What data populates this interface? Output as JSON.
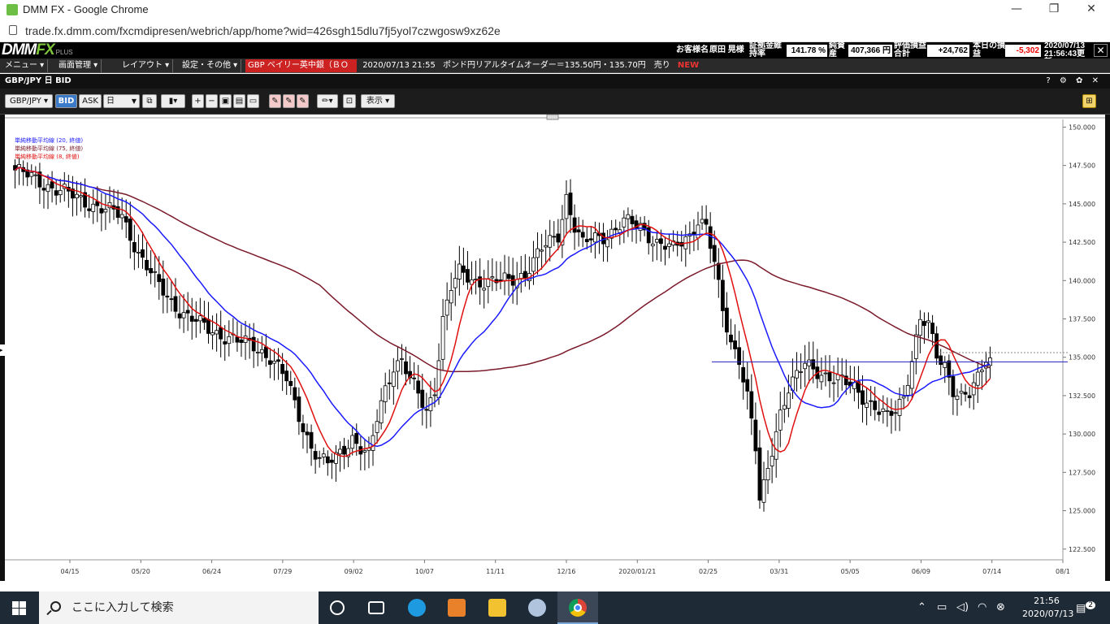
{
  "window": {
    "title": "DMM FX - Google Chrome",
    "url": "trade.fx.dmm.com/fxcmdipresen/webrich/app/home?wid=426sgh15dlu7fj5yol7czwgosw9xz62e"
  },
  "app": {
    "logo_main": "DMM",
    "logo_fx": "FX",
    "logo_plus": "PLUS",
    "account": {
      "name_label": "お客様名",
      "name_value": "原田 晃様",
      "margin_label": "証拠金維持率",
      "margin_value": "141.78 %",
      "equity_label": "純資産",
      "equity_value": "407,366 円",
      "eval_label": "評価損益合計",
      "eval_value": "+24,762 円",
      "today_label": "本日の損益",
      "today_value": "-5,302",
      "today_unit": "円",
      "updated_date": "2020/07/13",
      "updated_time": "21:56:43更新"
    },
    "menu": [
      "メニュー ▾",
      "画面管理 ▾",
      "レイアウト ▾",
      "設定・その他 ▾"
    ],
    "ticker": {
      "scroll": "GBP ベイリー英中銀（ＢＯ",
      "time": "2020/07/13 21:55",
      "text": "ポンド円リアルタイムオーダー＝135.50円・135.70円　売り",
      "new": "NEW"
    },
    "panel": {
      "title": "GBP/JPY 日 BID",
      "controls": "? ⚙ ✿ ✕"
    },
    "toolbar": {
      "pair": "GBP/JPY ▾",
      "bid": "BID",
      "ask": "ASK",
      "period": "日",
      "display": "表示 ▾"
    }
  },
  "chart_data": {
    "type": "candlestick",
    "title": "GBP/JPY 日 BID",
    "legend": [
      "単純移動平均線 (20, 終値)",
      "単純移動平均線 (75, 終値)",
      "単純移動平均線 (8, 終値)"
    ],
    "legend_colors": [
      "#1a1aff",
      "#7a1a2a",
      "#e01010"
    ],
    "y_ticks": [
      "150.000",
      "147.500",
      "145.000",
      "142.500",
      "140.000",
      "137.500",
      "135.000",
      "132.500",
      "130.000",
      "127.500",
      "125.000",
      "122.500"
    ],
    "ylim": [
      121.8,
      150.5
    ],
    "x_ticks": [
      "04/15",
      "05/20",
      "06/24",
      "07/29",
      "09/02",
      "10/07",
      "11/11",
      "12/16",
      "2020/01/21",
      "02/25",
      "03/31",
      "05/05",
      "06/09",
      "07/14",
      "08/1"
    ],
    "close_path": [
      [
        0,
        147.2
      ],
      [
        8,
        146.2
      ],
      [
        14,
        145.5
      ],
      [
        22,
        144.6
      ],
      [
        26,
        144.2
      ],
      [
        30,
        141.8
      ],
      [
        34,
        140.0
      ],
      [
        38,
        138.6
      ],
      [
        42,
        137.6
      ],
      [
        46,
        137.0
      ],
      [
        50,
        136.5
      ],
      [
        54,
        136.0
      ],
      [
        58,
        135.8
      ],
      [
        62,
        135.0
      ],
      [
        66,
        133.5
      ],
      [
        68,
        132.0
      ],
      [
        70,
        130.5
      ],
      [
        72,
        129.2
      ],
      [
        74,
        128.3
      ],
      [
        76,
        128.0
      ],
      [
        78,
        128.5
      ],
      [
        82,
        129.8
      ],
      [
        84,
        129.0
      ],
      [
        86,
        128.5
      ],
      [
        88,
        131.0
      ],
      [
        90,
        133.0
      ],
      [
        92,
        134.5
      ],
      [
        94,
        134.8
      ],
      [
        96,
        133.5
      ],
      [
        98,
        132.5
      ],
      [
        100,
        131.5
      ],
      [
        102,
        133.0
      ],
      [
        104,
        137.5
      ],
      [
        106,
        139.5
      ],
      [
        108,
        140.5
      ],
      [
        112,
        140.0
      ],
      [
        116,
        139.9
      ],
      [
        120,
        140.0
      ],
      [
        124,
        140.5
      ],
      [
        128,
        142.0
      ],
      [
        132,
        143.0
      ],
      [
        134,
        145.5
      ],
      [
        136,
        143.5
      ],
      [
        138,
        142.3
      ],
      [
        140,
        142.7
      ],
      [
        144,
        143.0
      ],
      [
        148,
        143.8
      ],
      [
        152,
        143.5
      ],
      [
        156,
        142.5
      ],
      [
        160,
        142.0
      ],
      [
        164,
        143.0
      ],
      [
        166,
        144.0
      ],
      [
        168,
        143.5
      ],
      [
        170,
        141.0
      ],
      [
        172,
        138.0
      ],
      [
        174,
        136.0
      ],
      [
        176,
        135.0
      ],
      [
        178,
        132.5
      ],
      [
        180,
        129.0
      ],
      [
        181,
        125.5
      ],
      [
        182,
        126.5
      ],
      [
        184,
        129.0
      ],
      [
        186,
        131.5
      ],
      [
        188,
        133.0
      ],
      [
        192,
        134.5
      ],
      [
        196,
        134.0
      ],
      [
        200,
        133.5
      ],
      [
        204,
        133.0
      ],
      [
        208,
        132.0
      ],
      [
        212,
        131.0
      ],
      [
        214,
        131.5
      ],
      [
        216,
        132.5
      ],
      [
        218,
        135.0
      ],
      [
        220,
        137.5
      ],
      [
        222,
        137.0
      ],
      [
        224,
        135.0
      ],
      [
        226,
        134.5
      ],
      [
        228,
        133.0
      ],
      [
        230,
        132.5
      ],
      [
        232,
        132.5
      ],
      [
        234,
        133.5
      ],
      [
        236,
        135.0
      ],
      [
        237,
        134.9
      ]
    ],
    "ma_levels": {
      "ma8_last": 133.6,
      "ma20_last": 133.8,
      "ma75_last": 133.5
    },
    "h_line": 134.7,
    "dotted_line": 135.3,
    "grid": false
  },
  "taskbar": {
    "search_placeholder": "ここに入力して検索",
    "time": "21:56",
    "date": "2020/07/13",
    "notif": "2"
  }
}
